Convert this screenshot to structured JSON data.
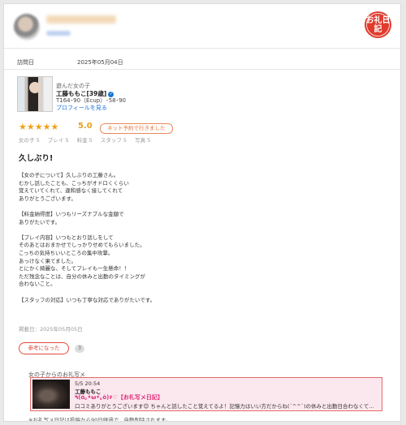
{
  "reviewer": {
    "avatar_icon": "user-avatar-icon",
    "name": "",
    "sub": ""
  },
  "stamp": {
    "text": "お礼日記",
    "color": "#e13b2e"
  },
  "visit": {
    "label": "訪問日",
    "date": "2025年05月04日"
  },
  "girl": {
    "played_label": "遊んだ女の子",
    "name": "工藤ももこ[39歳]",
    "verified_icon": "verified-check-icon",
    "spec": "T164･90（Ecup）･58･90",
    "profile_link": "プロフィールを見る"
  },
  "rating": {
    "stars": 5,
    "stars_text": "★★★★★",
    "score": "5.0",
    "badge": "ネット予約で行きました",
    "sub_scores": [
      "女の子 5",
      "プレイ 5",
      "料金 5",
      "スタッフ 5",
      "写真 5"
    ],
    "accent_color": "#f0a118"
  },
  "review": {
    "title": "久しぶり!",
    "lines": [
      "【女の子について】久しぶりの工藤さん。",
      "むかし話したことも、こっちがオドロくくらい",
      "覚えていてくれて、違和感なく接してくれて",
      "ありがとうございます。",
      "",
      "【料金納得度】いつもリーズナブルな金額で",
      "ありがたいです。",
      "",
      "【プレイ内容】いつもとおり話しをして",
      "そのあとはおまかせでしっかりせめてもらいました。",
      "こっちの気持ちいいところの集中攻撃。",
      "あっけなく果てました。",
      "とにかく綺麗な、そしてプレイも一生懸命！！",
      "ただ残念なことは、自分の休みと出勤のタイミングが",
      "合わないこと。",
      "",
      "【スタッフの対応】いつも丁寧な対応でありがたいです。"
    ],
    "posted": "掲載日：2025年05月05日",
    "helpful_label": "参考になった",
    "helpful_count": "3"
  },
  "thanks": {
    "label": "女の子からのお礼写メ",
    "time": "5/5 20:54",
    "name": "工藤ももこ",
    "title": "٩(ó｡•̀ω•́｡ò)۶♡【お礼写メ日記】",
    "text": "口コミありがとうございます😊 ちゃんと話したこと覚えてるよ！記憶力はいい方だからね(´^^`)の休みと出勤日合わなくて…",
    "border_color": "#e56a6a"
  },
  "note": "※お礼写メ日記は投稿から90日経過で、自動削除されます。"
}
